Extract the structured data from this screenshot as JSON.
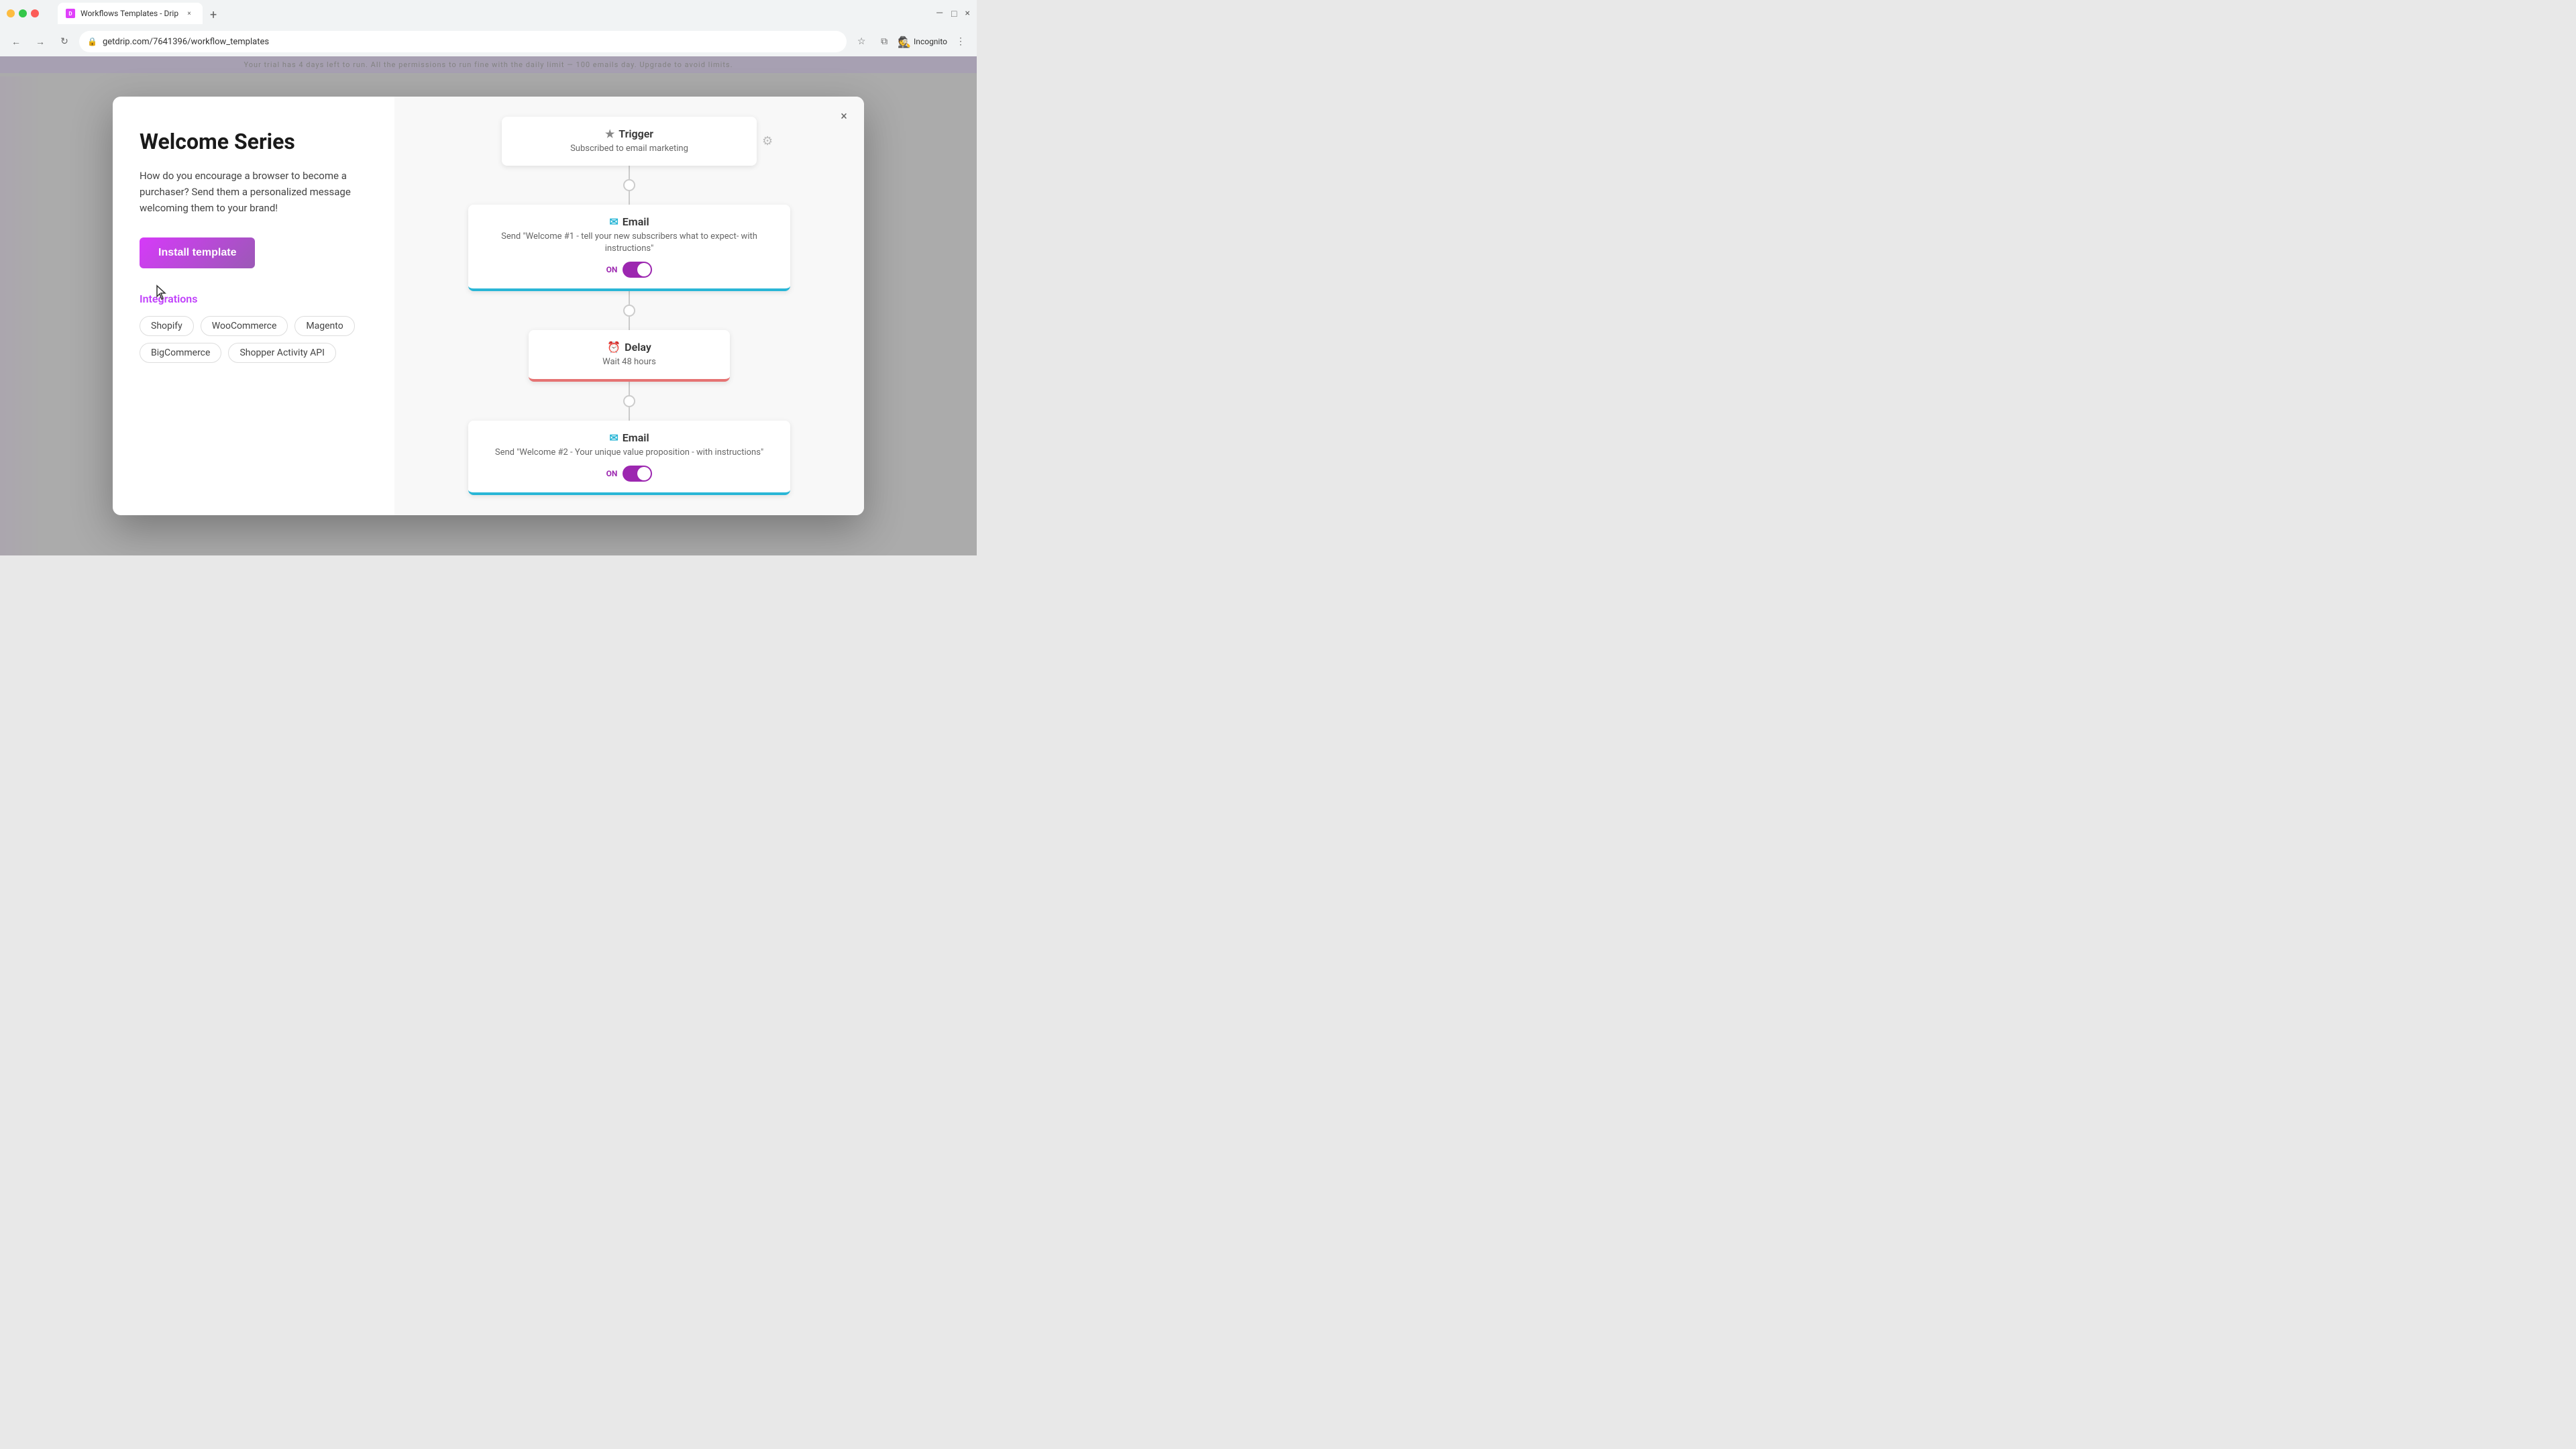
{
  "browser": {
    "tab_title": "Workflows Templates - Drip",
    "tab_new_label": "+",
    "nav_back": "←",
    "nav_forward": "→",
    "nav_refresh": "↻",
    "address": "getdrip.com/7641396/workflow_templates",
    "incognito_label": "Incognito",
    "window_controls": {
      "minimize": "—",
      "maximize": "□",
      "close": "×"
    }
  },
  "modal": {
    "close_label": "×",
    "title": "Welcome Series",
    "description": "How do you encourage a browser to become a purchaser? Send them a personalized message welcoming them to your brand!",
    "install_button": "Install template",
    "integrations_title": "Integrations",
    "integrations": [
      "Shopify",
      "WooCommerce",
      "Magento",
      "BigCommerce",
      "Shopper Activity API"
    ]
  },
  "workflow": {
    "trigger": {
      "label": "Trigger",
      "subtitle": "Subscribed to email marketing",
      "icon": "★"
    },
    "nodes": [
      {
        "type": "email",
        "label": "Email",
        "subtitle": "Send \"Welcome #1 - tell your new subscribers what to expect- with instructions\"",
        "toggle_label": "ON",
        "icon": "✉"
      },
      {
        "type": "delay",
        "label": "Delay",
        "subtitle": "Wait 48 hours",
        "icon": "⏰"
      },
      {
        "type": "email",
        "label": "Email",
        "subtitle": "Send \"Welcome #2 - Your unique value proposition - with instructions\"",
        "toggle_label": "ON",
        "icon": "✉"
      }
    ]
  },
  "colors": {
    "purple_accent": "#c040fb",
    "install_btn_start": "#d63af9",
    "install_btn_end": "#9b59b6",
    "email_border": "#29b6d6",
    "delay_border": "#e57373",
    "toggle_bg": "#9c27b0",
    "trigger_star": "#888888"
  }
}
